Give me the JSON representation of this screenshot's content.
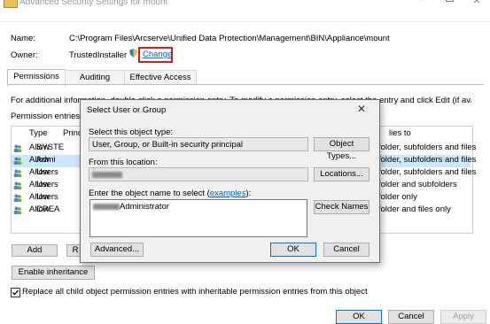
{
  "window": {
    "title": "Advanced Security Settings for mount"
  },
  "info": {
    "name_label": "Name:",
    "name_value": "C:\\Program Files\\Arcserve\\Unified Data Protection\\Management\\BIN\\Appliance\\mount",
    "owner_label": "Owner:",
    "owner_value": "TrustedInstaller",
    "change_link": "Change"
  },
  "tabs": [
    {
      "label": "Permissions"
    },
    {
      "label": "Auditing"
    },
    {
      "label": "Effective Access"
    }
  ],
  "panel": {
    "info_left": "For additional information, double-click a permission entry. To modify a permission entry, select the entry and click Edit (if available).",
    "info_right": "tries to",
    "entries_label": "Permission entries:"
  },
  "table": {
    "headers": {
      "type": "Type",
      "principal": "Princi",
      "applies": "lies to"
    },
    "rows": [
      {
        "type": "Allow",
        "principal": "SYSTE",
        "applies": "folder, subfolders and files"
      },
      {
        "type": "Allow",
        "principal": "Admi",
        "applies": "folder, subfolders and files"
      },
      {
        "type": "Allow",
        "principal": "Users",
        "applies": "folder, subfolders and files"
      },
      {
        "type": "Allow",
        "principal": "Users",
        "applies": "folder and subfolders"
      },
      {
        "type": "Allow",
        "principal": "Users",
        "applies": "folder only"
      },
      {
        "type": "Allow",
        "principal": "CREA",
        "applies": "folder and files only"
      }
    ]
  },
  "panel_buttons": {
    "add": "Add",
    "r": "R",
    "enable_inheritance": "Enable inheritance"
  },
  "replace_checkbox": {
    "label": "Replace all child object permission entries with inheritable permission entries from this object",
    "checked": true
  },
  "footer": {
    "ok": "OK",
    "cancel": "Cancel",
    "apply": "Apply"
  },
  "dialog": {
    "title": "Select User or Group",
    "close": "✕",
    "object_type_label": "Select this object type:",
    "object_type_value": "User, Group, or Built-in security principal",
    "object_types_button": "Object Types...",
    "location_label": "From this location:",
    "locations_button": "Locations...",
    "enter_label": "Enter the object name to select (",
    "examples_link": "examples",
    "enter_label_end": "):",
    "object_name_suffix": "Administrator",
    "check_names_button": "Check Names",
    "advanced_button": "Advanced...",
    "ok_button": "OK",
    "cancel_button": "Cancel"
  },
  "colors": {
    "accent": "#0078d7",
    "highlight_border": "#d61c1c",
    "selected_row": "#cce8ff",
    "link": "#0066cc"
  }
}
